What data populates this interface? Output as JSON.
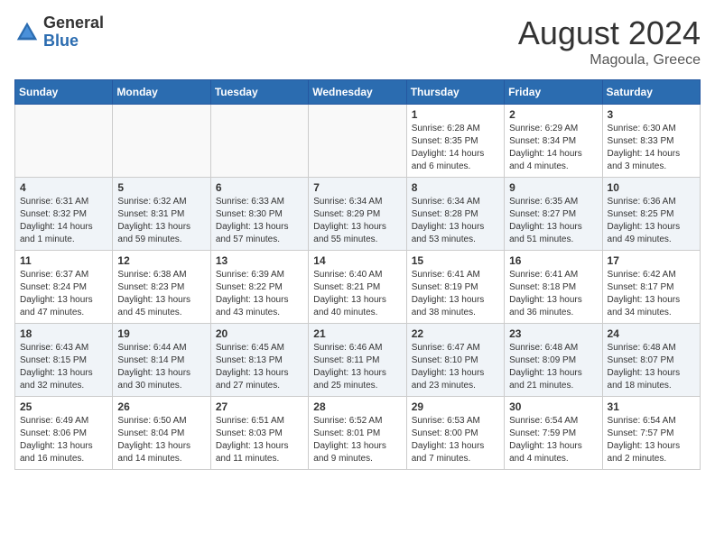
{
  "header": {
    "logo_general": "General",
    "logo_blue": "Blue",
    "month_year": "August 2024",
    "location": "Magoula, Greece"
  },
  "weekdays": [
    "Sunday",
    "Monday",
    "Tuesday",
    "Wednesday",
    "Thursday",
    "Friday",
    "Saturday"
  ],
  "weeks": [
    [
      {
        "day": "",
        "empty": true
      },
      {
        "day": "",
        "empty": true
      },
      {
        "day": "",
        "empty": true
      },
      {
        "day": "",
        "empty": true
      },
      {
        "day": "1",
        "sunrise": "6:28 AM",
        "sunset": "8:35 PM",
        "daylight": "14 hours and 6 minutes."
      },
      {
        "day": "2",
        "sunrise": "6:29 AM",
        "sunset": "8:34 PM",
        "daylight": "14 hours and 4 minutes."
      },
      {
        "day": "3",
        "sunrise": "6:30 AM",
        "sunset": "8:33 PM",
        "daylight": "14 hours and 3 minutes."
      }
    ],
    [
      {
        "day": "4",
        "sunrise": "6:31 AM",
        "sunset": "8:32 PM",
        "daylight": "14 hours and 1 minute."
      },
      {
        "day": "5",
        "sunrise": "6:32 AM",
        "sunset": "8:31 PM",
        "daylight": "13 hours and 59 minutes."
      },
      {
        "day": "6",
        "sunrise": "6:33 AM",
        "sunset": "8:30 PM",
        "daylight": "13 hours and 57 minutes."
      },
      {
        "day": "7",
        "sunrise": "6:34 AM",
        "sunset": "8:29 PM",
        "daylight": "13 hours and 55 minutes."
      },
      {
        "day": "8",
        "sunrise": "6:34 AM",
        "sunset": "8:28 PM",
        "daylight": "13 hours and 53 minutes."
      },
      {
        "day": "9",
        "sunrise": "6:35 AM",
        "sunset": "8:27 PM",
        "daylight": "13 hours and 51 minutes."
      },
      {
        "day": "10",
        "sunrise": "6:36 AM",
        "sunset": "8:25 PM",
        "daylight": "13 hours and 49 minutes."
      }
    ],
    [
      {
        "day": "11",
        "sunrise": "6:37 AM",
        "sunset": "8:24 PM",
        "daylight": "13 hours and 47 minutes."
      },
      {
        "day": "12",
        "sunrise": "6:38 AM",
        "sunset": "8:23 PM",
        "daylight": "13 hours and 45 minutes."
      },
      {
        "day": "13",
        "sunrise": "6:39 AM",
        "sunset": "8:22 PM",
        "daylight": "13 hours and 43 minutes."
      },
      {
        "day": "14",
        "sunrise": "6:40 AM",
        "sunset": "8:21 PM",
        "daylight": "13 hours and 40 minutes."
      },
      {
        "day": "15",
        "sunrise": "6:41 AM",
        "sunset": "8:19 PM",
        "daylight": "13 hours and 38 minutes."
      },
      {
        "day": "16",
        "sunrise": "6:41 AM",
        "sunset": "8:18 PM",
        "daylight": "13 hours and 36 minutes."
      },
      {
        "day": "17",
        "sunrise": "6:42 AM",
        "sunset": "8:17 PM",
        "daylight": "13 hours and 34 minutes."
      }
    ],
    [
      {
        "day": "18",
        "sunrise": "6:43 AM",
        "sunset": "8:15 PM",
        "daylight": "13 hours and 32 minutes."
      },
      {
        "day": "19",
        "sunrise": "6:44 AM",
        "sunset": "8:14 PM",
        "daylight": "13 hours and 30 minutes."
      },
      {
        "day": "20",
        "sunrise": "6:45 AM",
        "sunset": "8:13 PM",
        "daylight": "13 hours and 27 minutes."
      },
      {
        "day": "21",
        "sunrise": "6:46 AM",
        "sunset": "8:11 PM",
        "daylight": "13 hours and 25 minutes."
      },
      {
        "day": "22",
        "sunrise": "6:47 AM",
        "sunset": "8:10 PM",
        "daylight": "13 hours and 23 minutes."
      },
      {
        "day": "23",
        "sunrise": "6:48 AM",
        "sunset": "8:09 PM",
        "daylight": "13 hours and 21 minutes."
      },
      {
        "day": "24",
        "sunrise": "6:48 AM",
        "sunset": "8:07 PM",
        "daylight": "13 hours and 18 minutes."
      }
    ],
    [
      {
        "day": "25",
        "sunrise": "6:49 AM",
        "sunset": "8:06 PM",
        "daylight": "13 hours and 16 minutes."
      },
      {
        "day": "26",
        "sunrise": "6:50 AM",
        "sunset": "8:04 PM",
        "daylight": "13 hours and 14 minutes."
      },
      {
        "day": "27",
        "sunrise": "6:51 AM",
        "sunset": "8:03 PM",
        "daylight": "13 hours and 11 minutes."
      },
      {
        "day": "28",
        "sunrise": "6:52 AM",
        "sunset": "8:01 PM",
        "daylight": "13 hours and 9 minutes."
      },
      {
        "day": "29",
        "sunrise": "6:53 AM",
        "sunset": "8:00 PM",
        "daylight": "13 hours and 7 minutes."
      },
      {
        "day": "30",
        "sunrise": "6:54 AM",
        "sunset": "7:59 PM",
        "daylight": "13 hours and 4 minutes."
      },
      {
        "day": "31",
        "sunrise": "6:54 AM",
        "sunset": "7:57 PM",
        "daylight": "13 hours and 2 minutes."
      }
    ]
  ]
}
